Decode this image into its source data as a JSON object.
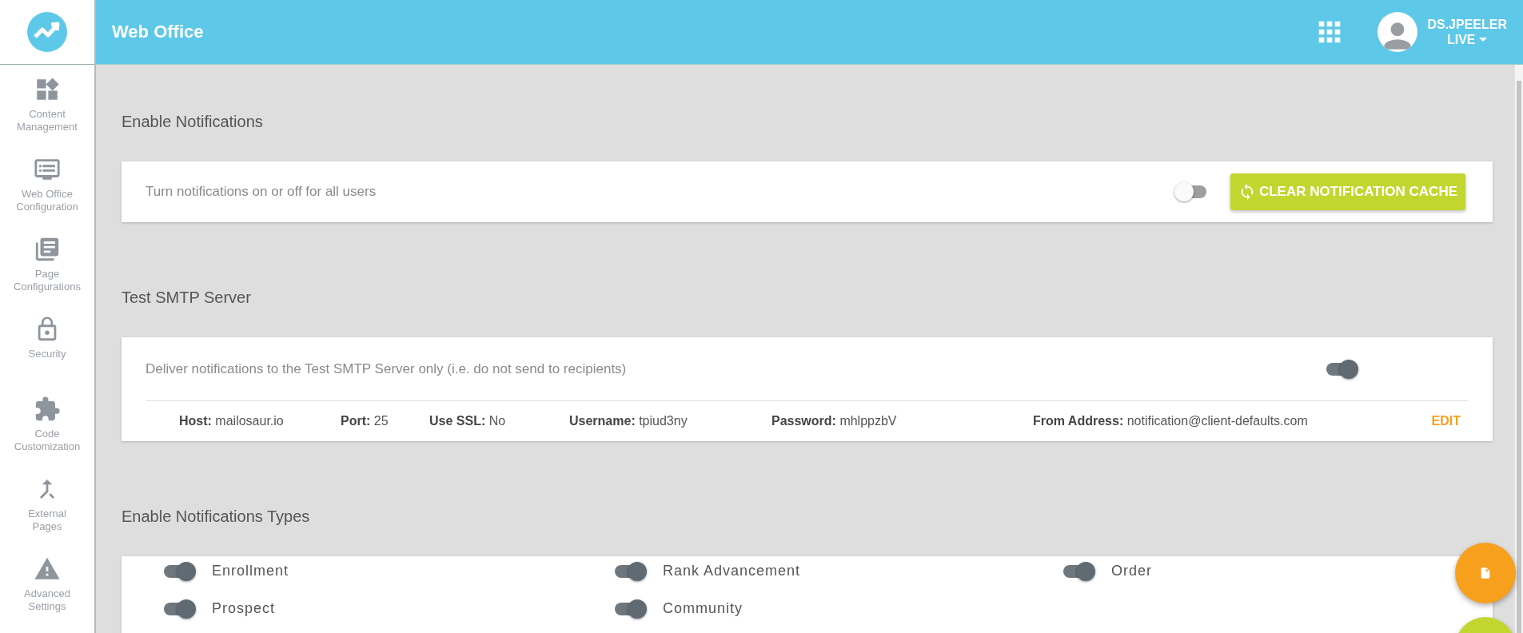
{
  "header": {
    "title": "Web Office",
    "user": "DS.JPEELER",
    "environment": "LIVE"
  },
  "sidebar": {
    "items": [
      {
        "label": "Content Management",
        "kind": "widgets"
      },
      {
        "label": "Web Office Configuration",
        "kind": "monitor"
      },
      {
        "label": "Page Configurations",
        "kind": "pages"
      },
      {
        "label": "Security",
        "kind": "lock"
      },
      {
        "label": "Code Customization",
        "kind": "puzzle"
      },
      {
        "label": "External Pages",
        "kind": "merge"
      },
      {
        "label": "Advanced Settings",
        "kind": "warning"
      }
    ]
  },
  "notifications": {
    "title": "Enable Notifications",
    "description": "Turn notifications on or off for all users",
    "on": false,
    "button": "CLEAR NOTIFICATION CACHE"
  },
  "smtp": {
    "title": "Test SMTP Server",
    "description": "Deliver notifications to the Test SMTP Server only (i.e. do not send to recipients)",
    "on": true,
    "fields": [
      {
        "label": "Host:",
        "value": "mailosaur.io"
      },
      {
        "label": "Port:",
        "value": "25"
      },
      {
        "label": "Use SSL:",
        "value": "No"
      },
      {
        "label": "Username:",
        "value": "tpiud3ny"
      },
      {
        "label": "Password:",
        "value": "mhlppzbV"
      },
      {
        "label": "From Address:",
        "value": "notification@client-defaults.com"
      }
    ],
    "edit": "EDIT"
  },
  "types": {
    "title": "Enable Notifications Types",
    "items": [
      {
        "label": "Enrollment",
        "on": true
      },
      {
        "label": "Rank Advancement",
        "on": true
      },
      {
        "label": "Order",
        "on": true
      },
      {
        "label": "Prospect",
        "on": true
      },
      {
        "label": "Community",
        "on": true
      }
    ]
  }
}
